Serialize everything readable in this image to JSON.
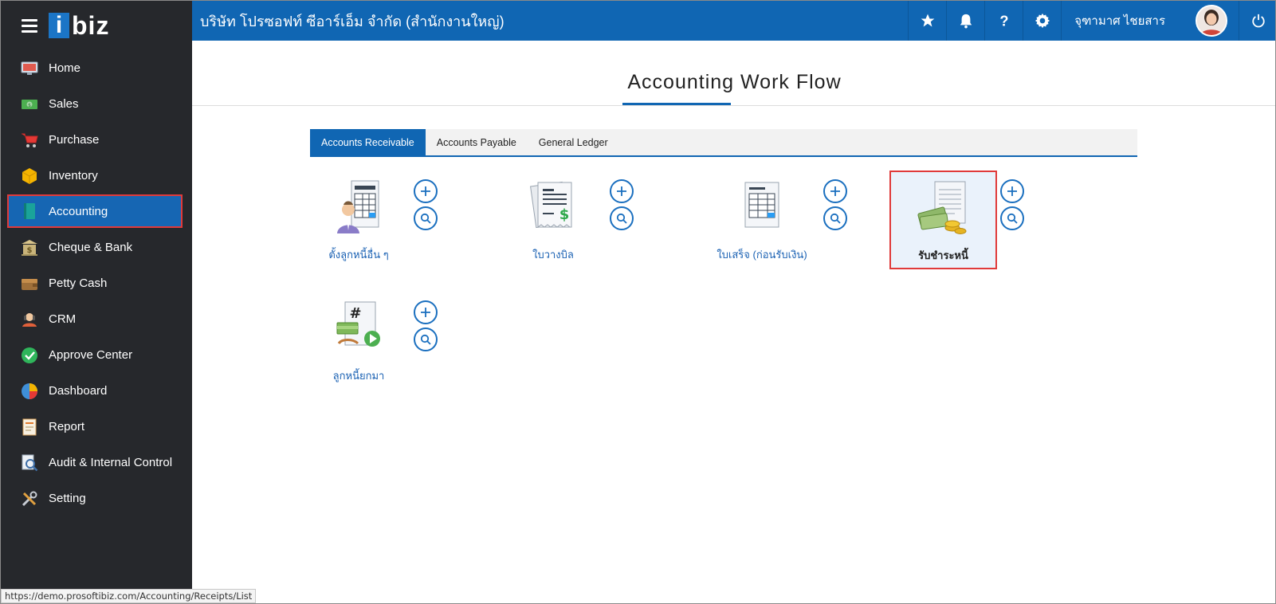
{
  "app": {
    "logo_i": "i",
    "logo_rest": "biz",
    "company": "บริษัท โปรซอฟท์ ซีอาร์เอ็ม จำกัด (สำนักงานใหญ่)",
    "user_name": "จุฑามาศ ไชยสาร"
  },
  "sidebar": {
    "items": [
      {
        "label": "Home",
        "icon": "home-icon"
      },
      {
        "label": "Sales",
        "icon": "sales-icon"
      },
      {
        "label": "Purchase",
        "icon": "cart-icon"
      },
      {
        "label": "Inventory",
        "icon": "box-icon"
      },
      {
        "label": "Accounting",
        "icon": "book-icon",
        "active": true
      },
      {
        "label": "Cheque & Bank",
        "icon": "bank-icon"
      },
      {
        "label": "Petty Cash",
        "icon": "wallet-icon"
      },
      {
        "label": "CRM",
        "icon": "crm-icon"
      },
      {
        "label": "Approve Center",
        "icon": "check-icon"
      },
      {
        "label": "Dashboard",
        "icon": "pie-chart-icon"
      },
      {
        "label": "Report",
        "icon": "report-icon"
      },
      {
        "label": "Audit & Internal Control",
        "icon": "audit-icon"
      },
      {
        "label": "Setting",
        "icon": "tools-icon"
      }
    ]
  },
  "page": {
    "title": "Accounting Work Flow",
    "tabs": [
      {
        "label": "Accounts Receivable",
        "active": true
      },
      {
        "label": "Accounts Payable"
      },
      {
        "label": "General Ledger"
      }
    ]
  },
  "workflow": [
    {
      "label": "ตั้งลูกหนี้อื่น ๆ",
      "icon": "other-debtor-icon"
    },
    {
      "label": "ใบวางบิล",
      "icon": "billing-note-icon"
    },
    {
      "label": "ใบเสร็จ (ก่อนรับเงิน)",
      "icon": "receipt-icon"
    },
    {
      "label": "รับชำระหนี้",
      "icon": "debt-payment-icon",
      "selected": true
    },
    {
      "label": "ลูกหนี้ยกมา",
      "icon": "opening-debtor-icon"
    }
  ],
  "status_bar": {
    "url": "https://demo.prosoftibiz.com/Accounting/Receipts/List"
  },
  "colors": {
    "sidebar_bg": "#26282c",
    "primary": "#1066b3",
    "highlight_border": "#e03a3a"
  }
}
